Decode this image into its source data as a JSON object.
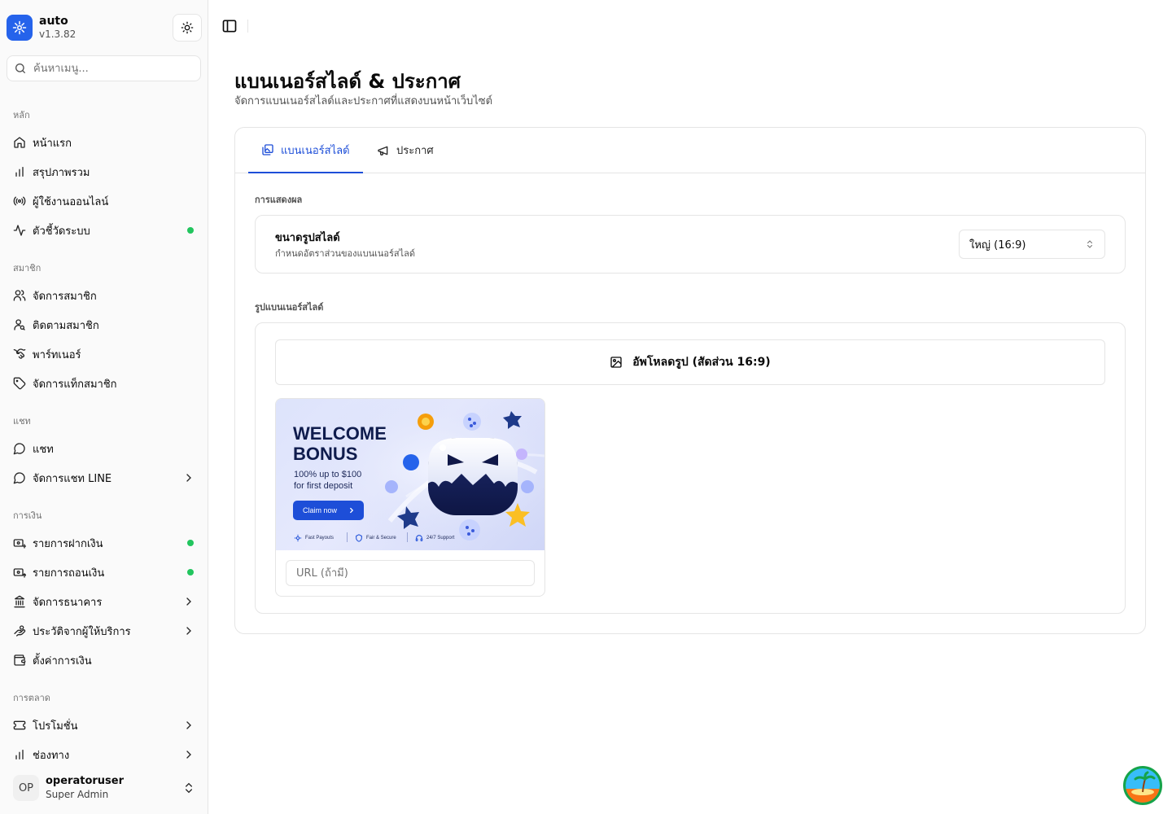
{
  "brand": {
    "name": "auto",
    "version": "v1.3.82"
  },
  "search": {
    "placeholder": "ค้นหาเมนู..."
  },
  "sidebar": {
    "groups": [
      {
        "label": "หลัก"
      },
      {
        "label": "สมาชิก"
      },
      {
        "label": "แชท"
      },
      {
        "label": "การเงิน"
      },
      {
        "label": "การตลาด"
      }
    ],
    "items": [
      {
        "label": "หน้าแรก",
        "icon": "home-icon"
      },
      {
        "label": "สรุปภาพรวม",
        "icon": "bar-chart-icon"
      },
      {
        "label": "ผู้ใช้งานออนไลน์",
        "icon": "radio-icon"
      },
      {
        "label": "ตัวชี้วัดระบบ",
        "icon": "activity-icon",
        "status": "online"
      },
      {
        "label": "จัดการสมาชิก",
        "icon": "users-icon"
      },
      {
        "label": "ติดตามสมาชิก",
        "icon": "user-search-icon"
      },
      {
        "label": "พาร์ทเนอร์",
        "icon": "handshake-icon"
      },
      {
        "label": "จัดการแท็กสมาชิก",
        "icon": "tag-icon"
      },
      {
        "label": "แชท",
        "icon": "message-circle-icon"
      },
      {
        "label": "จัดการแชท LINE",
        "icon": "message-circle-icon",
        "expandable": true
      },
      {
        "label": "รายการฝากเงิน",
        "icon": "banknote-in-icon",
        "status": "online"
      },
      {
        "label": "รายการถอนเงิน",
        "icon": "banknote-out-icon",
        "status": "online"
      },
      {
        "label": "จัดการธนาคาร",
        "icon": "landmark-icon",
        "expandable": true
      },
      {
        "label": "ประวัติจากผู้ให้บริการ",
        "icon": "hand-coins-icon",
        "expandable": true
      },
      {
        "label": "ตั้งค่าการเงิน",
        "icon": "wallet-icon"
      },
      {
        "label": "โปรโมชั่น",
        "icon": "ticket-icon",
        "expandable": true
      },
      {
        "label": "ช่องทาง",
        "icon": "bar-chart-icon",
        "expandable": true
      }
    ],
    "status_color": "#22c55e"
  },
  "user": {
    "initials": "OP",
    "name": "operatoruser",
    "role": "Super Admin"
  },
  "page": {
    "title": "แบนเนอร์สไลด์ & ประกาศ",
    "subtitle": "จัดการแบนเนอร์สไลด์และประกาศที่แสดงบนหน้าเว็บไซต์"
  },
  "tabs": [
    {
      "label": "แบนเนอร์สไลด์",
      "icon": "images-icon",
      "active": true
    },
    {
      "label": "ประกาศ",
      "icon": "megaphone-icon",
      "active": false
    }
  ],
  "display": {
    "section_label": "การแสดงผล",
    "slide_size": {
      "title": "ขนาดรูปสไลด์",
      "description": "กำหนดอัตราส่วนของแบนเนอร์สไลด์",
      "selected": "ใหญ่ (16:9)"
    }
  },
  "images": {
    "section_label": "รูปแบนเนอร์สไลด์",
    "upload_label": "อัพโหลดรูป (สัดส่วน 16:9)",
    "slides": [
      {
        "banner": {
          "title_line1": "WELCOME",
          "title_line2": "BONUS",
          "sub_line1": "100% up to $100",
          "sub_line2": "for first deposit",
          "cta": "Claim now",
          "features": [
            "Fast Payouts",
            "Fair & Secure",
            "24/7 Support"
          ]
        },
        "url_placeholder": "URL (ถ้ามี)",
        "url_value": ""
      }
    ]
  },
  "colors": {
    "accent": "#1d4ed8",
    "brand": "#2563eb",
    "border": "#e5e5e5"
  }
}
